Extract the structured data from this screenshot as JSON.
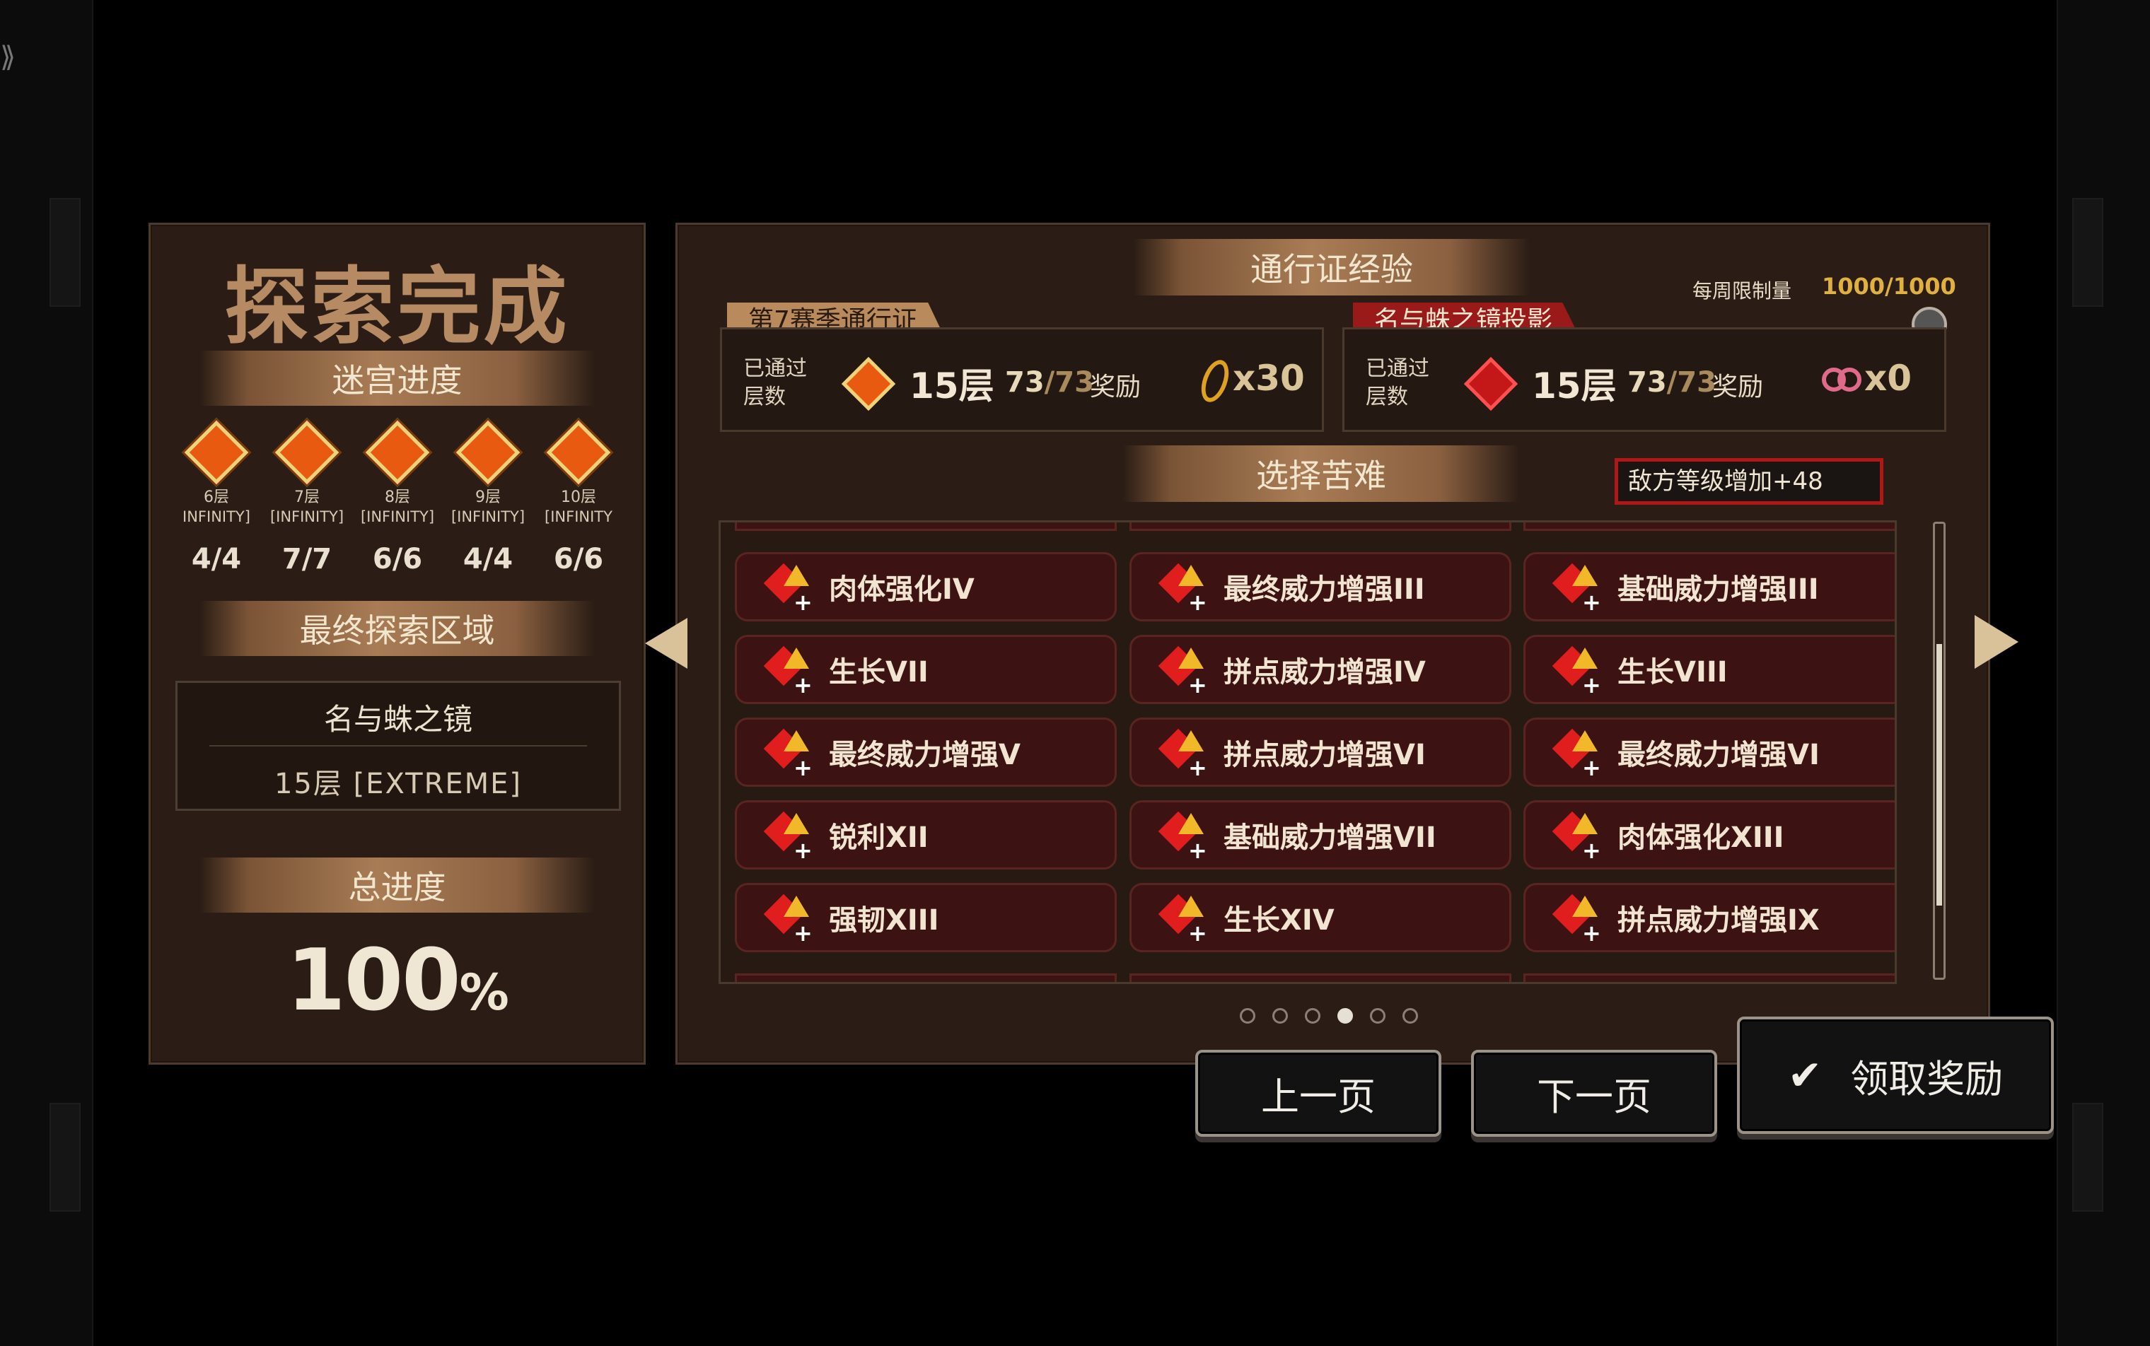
{
  "left_panel": {
    "title": "探索完成",
    "labyrinth_header": "迷宫进度",
    "floors": [
      {
        "label": "6层",
        "sub": "INFINITY]",
        "count": "4/4"
      },
      {
        "label": "7层",
        "sub": "[INFINITY]",
        "count": "7/7"
      },
      {
        "label": "8层",
        "sub": "[INFINITY]",
        "count": "6/6"
      },
      {
        "label": "9层",
        "sub": "[INFINITY]",
        "count": "4/4"
      },
      {
        "label": "10层",
        "sub": "[INFINITY",
        "count": "6/6"
      }
    ],
    "final_area_header": "最终探索区域",
    "final_area_name": "名与蛛之镜",
    "final_area_floor": "15层 [EXTREME]",
    "total_header": "总进度",
    "total_value": "100",
    "total_unit": "%"
  },
  "right_panel": {
    "pass_exp_header": "通行证经验",
    "weekly_limit_label": "每周限制量",
    "weekly_limit_value": "1000/1000",
    "season_pass": {
      "tag": "第7赛季通行证",
      "passed_label_1": "已通过",
      "passed_label_2": "层数",
      "floor": "15层",
      "progress_num": "73",
      "progress_den": "/73",
      "reward_label": "奖励",
      "reward_count": "x30"
    },
    "mirror_pass": {
      "tag": "名与蛛之镜投影",
      "passed_label_1": "已通过",
      "passed_label_2": "层数",
      "floor": "15层",
      "progress_num": "73",
      "progress_den": "/73",
      "reward_label": "奖励",
      "reward_count": "x0"
    },
    "hardship_header": "选择苦难",
    "enemy_level": "敌方等级增加+48",
    "cards": [
      "肉体强化IV",
      "最终威力增强III",
      "基础威力增强III",
      "生长VII",
      "拼点威力增强IV",
      "生长VIII",
      "最终威力增强V",
      "拼点威力增强VI",
      "最终威力增强VI",
      "锐利XII",
      "基础威力增强VII",
      "肉体强化XIII",
      "强韧XIII",
      "生长XIV",
      "拼点威力增强IX"
    ],
    "page_dots": 6,
    "active_dot": 3
  },
  "buttons": {
    "prev": "上一页",
    "next": "下一页",
    "claim": "领取奖励",
    "claim_icon": "check-icon"
  },
  "colors": {
    "panel_bg": "#2b1d15",
    "card_bg": "#3c1312",
    "accent_gold": "#c8a67a",
    "danger_red": "#c42020"
  }
}
